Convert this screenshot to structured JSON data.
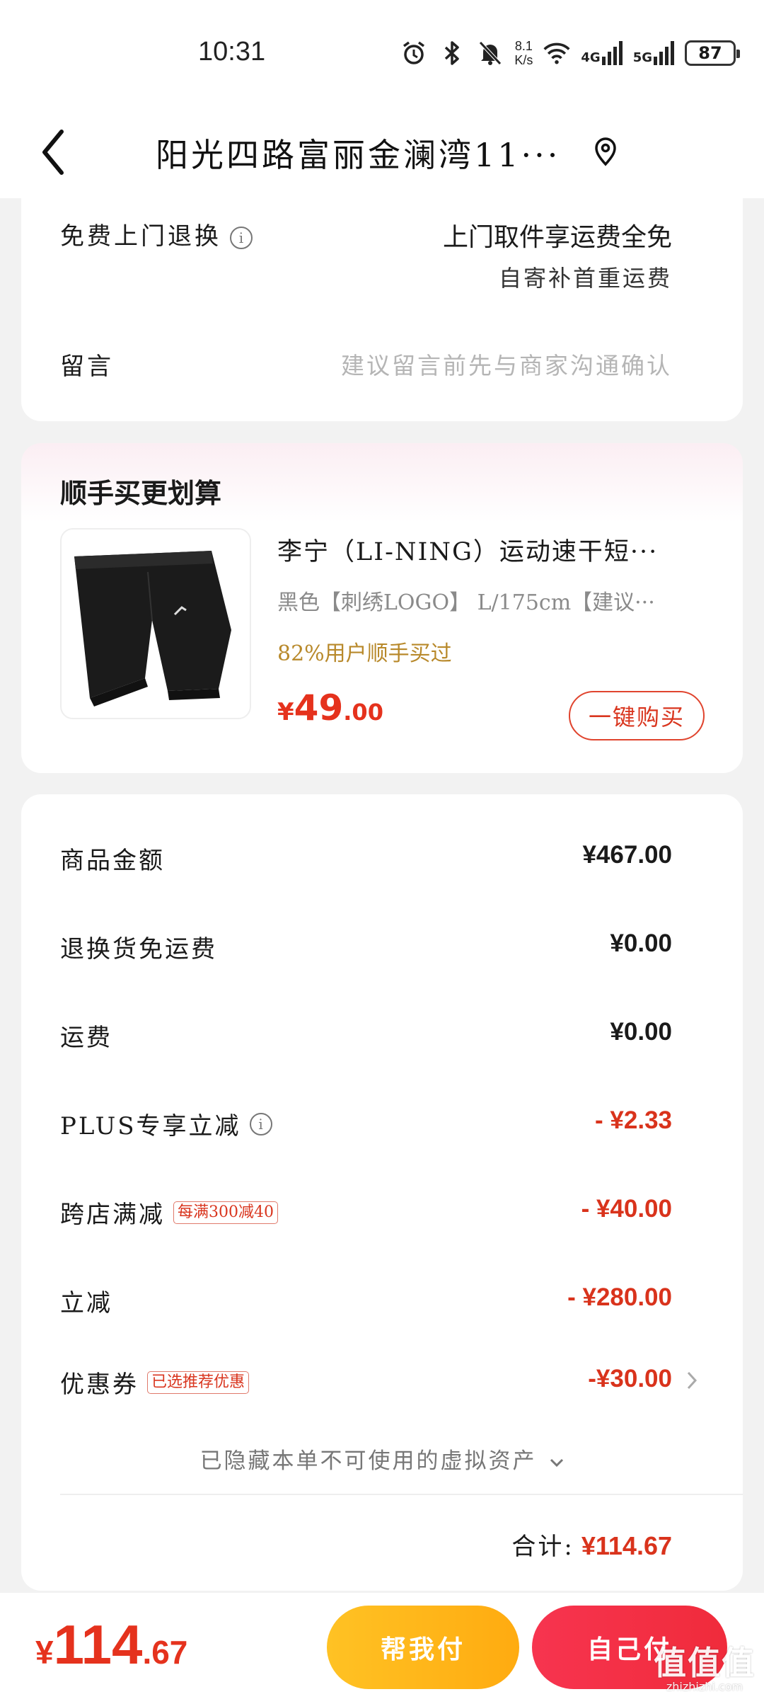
{
  "status_bar": {
    "time": "10:31",
    "net_speed_value": "8.1",
    "net_speed_unit": "K/s",
    "signal1_label": "4G",
    "signal2_label": "5G",
    "battery": "87",
    "icons": [
      "alarm-icon",
      "bluetooth-icon",
      "mute-icon",
      "wifi-icon",
      "signal-icon",
      "battery-icon"
    ]
  },
  "header": {
    "title": "阳光四路富丽金澜湾11···"
  },
  "delivery": {
    "return_label": "免费上门退换",
    "return_value_line1": "上门取件享运费全免",
    "return_value_line2": "自寄补首重运费",
    "message_label": "留言",
    "message_placeholder": "建议留言前先与商家沟通确认"
  },
  "addon": {
    "section_title": "顺手买更划算",
    "product_name": "李宁（LI-NING）运动速干短···",
    "product_spec": "黑色【刺绣LOGO】  L/175cm【建议···",
    "product_tag": "82%用户顺手买过",
    "price_currency": "¥",
    "price_int": "49",
    "price_dec": ".00",
    "buy_label": "一键购买"
  },
  "amounts": {
    "rows": [
      {
        "label": "商品金额",
        "value": "¥467.00"
      },
      {
        "label": "退换货免运费",
        "value": "¥0.00"
      },
      {
        "label": "运费",
        "value": "¥0.00"
      },
      {
        "label": "PLUS专享立减",
        "value": "- ¥2.33"
      },
      {
        "label": "跨店满减",
        "badge": "每满300减40",
        "value": "- ¥40.00"
      },
      {
        "label": "立减",
        "value": "- ¥280.00"
      },
      {
        "label": "优惠券",
        "badge": "已选推荐优惠",
        "value": "-¥30.00"
      }
    ],
    "hidden_note": "已隐藏本单不可使用的虚拟资产",
    "total_label": "合计:",
    "total_value": "¥114.67"
  },
  "bottom_bar": {
    "currency": "¥",
    "total_int": "114",
    "total_dec": ".67",
    "help_pay_label": "帮我付",
    "self_pay_label": "自己付"
  },
  "watermark": {
    "logo": "值值值",
    "url": "zhizhizhi.com"
  },
  "colors": {
    "accent_red": "#d9331c",
    "gold_tag": "#b8892b",
    "help_pay": "#ffb818",
    "self_pay": "#f2303f"
  }
}
